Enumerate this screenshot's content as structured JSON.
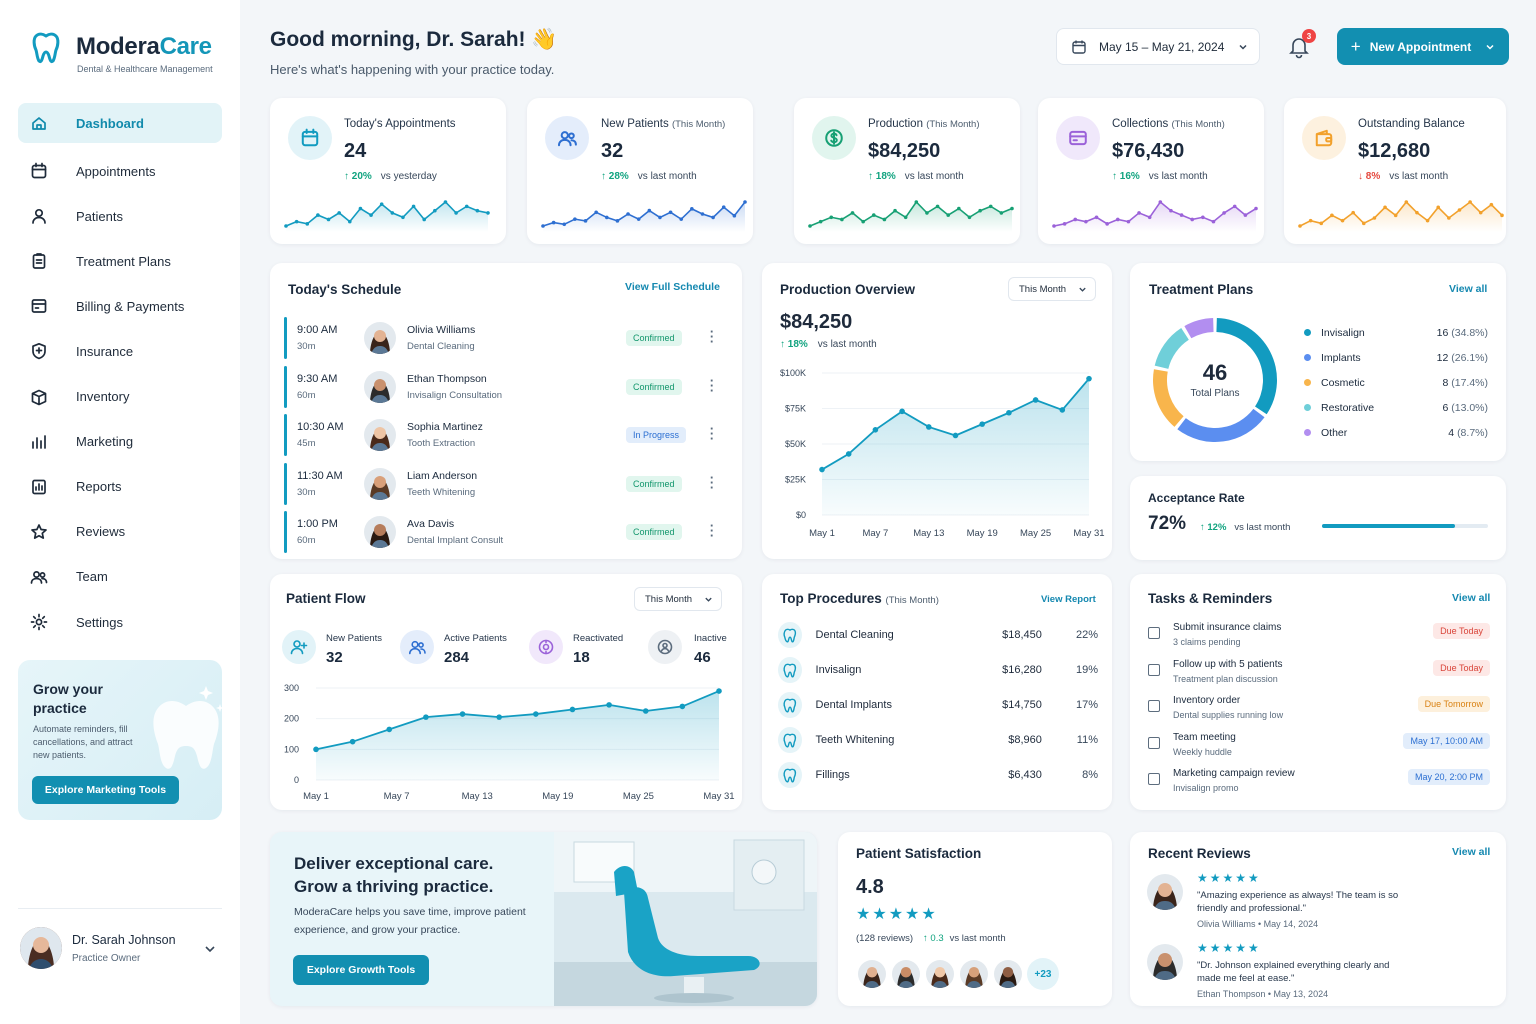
{
  "brand": {
    "name_a": "Modera",
    "name_b": "Care",
    "tagline": "Dental & Healthcare Management"
  },
  "nav": [
    {
      "label": "Dashboard",
      "icon": "home-icon",
      "active": true
    },
    {
      "label": "Appointments",
      "icon": "calendar-icon"
    },
    {
      "label": "Patients",
      "icon": "user-icon"
    },
    {
      "label": "Treatment Plans",
      "icon": "clipboard-icon"
    },
    {
      "label": "Billing & Payments",
      "icon": "credit-card-icon"
    },
    {
      "label": "Insurance",
      "icon": "shield-icon"
    },
    {
      "label": "Inventory",
      "icon": "box-icon"
    },
    {
      "label": "Marketing",
      "icon": "bar-chart-icon"
    },
    {
      "label": "Reports",
      "icon": "report-icon"
    },
    {
      "label": "Reviews",
      "icon": "star-icon"
    },
    {
      "label": "Team",
      "icon": "team-icon"
    },
    {
      "label": "Settings",
      "icon": "gear-icon"
    }
  ],
  "promo": {
    "title": "Grow your practice",
    "text": "Automate reminders, fill cancellations, and attract new patients.",
    "button": "Explore Marketing Tools"
  },
  "user": {
    "name": "Dr. Sarah Johnson",
    "role": "Practice Owner"
  },
  "header": {
    "greeting": "Good morning, Dr. Sarah! 👋",
    "subtitle": "Here's what's happening with your practice today.",
    "date_range": "May 15 – May 21, 2024",
    "notifications": "3",
    "new_button": "New Appointment"
  },
  "kpis": [
    {
      "label": "Today's Appointments",
      "sub": "",
      "value": "24",
      "delta": "20%",
      "dir": "up",
      "vs": "vs yesterday",
      "color": "#129bc0",
      "bg": "#e2f3f8",
      "icon": "calendar-icon",
      "spark": [
        12,
        14,
        13,
        17,
        15,
        18,
        14,
        20,
        17,
        22,
        18,
        16,
        21,
        15,
        19,
        23,
        18,
        21,
        19,
        18
      ]
    },
    {
      "label": "New Patients",
      "sub": "(This Month)",
      "value": "32",
      "delta": "28%",
      "dir": "up",
      "vs": "vs last month",
      "color": "#2e6fd1",
      "bg": "#e4edfb",
      "icon": "users-icon",
      "spark": [
        10,
        12,
        11,
        14,
        13,
        18,
        15,
        13,
        17,
        14,
        19,
        15,
        18,
        14,
        20,
        17,
        15,
        21,
        16,
        24
      ]
    },
    {
      "label": "Production",
      "sub": "(This Month)",
      "value": "$84,250",
      "delta": "18%",
      "dir": "up",
      "vs": "vs last month",
      "color": "#17a074",
      "bg": "#e1f5ee",
      "icon": "dollar-icon",
      "spark": [
        12,
        14,
        16,
        15,
        18,
        14,
        17,
        15,
        19,
        16,
        23,
        18,
        21,
        17,
        20,
        16,
        19,
        21,
        18,
        20
      ]
    },
    {
      "label": "Collections",
      "sub": "(This Month)",
      "value": "$76,430",
      "delta": "16%",
      "dir": "up",
      "vs": "vs last month",
      "color": "#9b62d9",
      "bg": "#f0e8fb",
      "icon": "wallet-icon",
      "spark": [
        10,
        11,
        13,
        12,
        14,
        11,
        13,
        12,
        16,
        14,
        21,
        17,
        15,
        13,
        14,
        12,
        16,
        19,
        15,
        18
      ]
    },
    {
      "label": "Outstanding Balance",
      "sub": "",
      "value": "$12,680",
      "delta": "8%",
      "dir": "down",
      "vs": "vs last month",
      "color": "#f2a12c",
      "bg": "#fdf1df",
      "icon": "folder-wallet-icon",
      "spark": [
        12,
        14,
        13,
        16,
        14,
        17,
        13,
        15,
        19,
        16,
        21,
        17,
        14,
        19,
        15,
        18,
        21,
        17,
        20,
        16
      ]
    }
  ],
  "schedule": {
    "title": "Today's Schedule",
    "link": "View Full Schedule",
    "rows": [
      {
        "time": "9:00 AM",
        "dur": "30m",
        "name": "Olivia Williams",
        "proc": "Dental Cleaning",
        "status": "Confirmed",
        "kind": "green"
      },
      {
        "time": "9:30 AM",
        "dur": "60m",
        "name": "Ethan Thompson",
        "proc": "Invisalign Consultation",
        "status": "Confirmed",
        "kind": "green"
      },
      {
        "time": "10:30 AM",
        "dur": "45m",
        "name": "Sophia Martinez",
        "proc": "Tooth Extraction",
        "status": "In Progress",
        "kind": "blue"
      },
      {
        "time": "11:30 AM",
        "dur": "30m",
        "name": "Liam Anderson",
        "proc": "Teeth Whitening",
        "status": "Confirmed",
        "kind": "green"
      },
      {
        "time": "1:00 PM",
        "dur": "60m",
        "name": "Ava Davis",
        "proc": "Dental Implant Consult",
        "status": "Confirmed",
        "kind": "green"
      }
    ]
  },
  "production": {
    "title": "Production Overview",
    "period": "This Month",
    "value": "$84,250",
    "delta": "18%",
    "vs": "vs last month"
  },
  "treatment": {
    "title": "Treatment Plans",
    "link": "View all",
    "total": "46",
    "total_label": "Total Plans",
    "items": [
      {
        "label": "Invisalign",
        "count": "16",
        "pct": "(34.8%)",
        "color": "#129bc0",
        "value": 16
      },
      {
        "label": "Implants",
        "count": "12",
        "pct": "(26.1%)",
        "color": "#5b8ef0",
        "value": 12
      },
      {
        "label": "Cosmetic",
        "count": "8",
        "pct": "(17.4%)",
        "color": "#f8b54c",
        "value": 8
      },
      {
        "label": "Restorative",
        "count": "6",
        "pct": "(13.0%)",
        "color": "#6fcfd9",
        "value": 6
      },
      {
        "label": "Other",
        "count": "4",
        "pct": "(8.7%)",
        "color": "#b28ef0",
        "value": 4
      }
    ]
  },
  "acceptance": {
    "title": "Acceptance Rate",
    "value": "72%",
    "delta": "12%",
    "vs": "vs last month",
    "progress": 0.8
  },
  "flow": {
    "title": "Patient Flow",
    "period": "This Month",
    "stats": [
      {
        "label": "New Patients",
        "value": "32",
        "icon": "user-plus-icon",
        "bg": "#e2f3f8",
        "color": "#129bc0"
      },
      {
        "label": "Active Patients",
        "value": "284",
        "icon": "users-icon",
        "bg": "#e4edfb",
        "color": "#2e6fd1"
      },
      {
        "label": "Reactivated",
        "value": "18",
        "icon": "refresh-icon",
        "bg": "#f1e8fb",
        "color": "#9b62d9"
      },
      {
        "label": "Inactive",
        "value": "46",
        "icon": "inactive-icon",
        "bg": "#eef1f4",
        "color": "#5d6d7e"
      }
    ]
  },
  "procedures": {
    "title": "Top Procedures",
    "sub": "(This Month)",
    "link": "View Report",
    "rows": [
      {
        "name": "Dental Cleaning",
        "amount": "$18,450",
        "pct": "22%"
      },
      {
        "name": "Invisalign",
        "amount": "$16,280",
        "pct": "19%"
      },
      {
        "name": "Dental Implants",
        "amount": "$14,750",
        "pct": "17%"
      },
      {
        "name": "Teeth Whitening",
        "amount": "$8,960",
        "pct": "11%"
      },
      {
        "name": "Fillings",
        "amount": "$6,430",
        "pct": "8%"
      }
    ]
  },
  "tasks": {
    "title": "Tasks & Reminders",
    "link": "View all",
    "rows": [
      {
        "title": "Submit insurance claims",
        "sub": "3 claims pending",
        "due": "Due Today",
        "kind": "red"
      },
      {
        "title": "Follow up with 5 patients",
        "sub": "Treatment plan discussion",
        "due": "Due Today",
        "kind": "red"
      },
      {
        "title": "Inventory order",
        "sub": "Dental supplies running low",
        "due": "Due Tomorrow",
        "kind": "orange"
      },
      {
        "title": "Team meeting",
        "sub": "Weekly huddle",
        "due": "May 17, 10:00 AM",
        "kind": "blue"
      },
      {
        "title": "Marketing campaign review",
        "sub": "Invisalign promo",
        "due": "May 20, 2:00 PM",
        "kind": "blue"
      }
    ]
  },
  "banner": {
    "line1": "Deliver exceptional care.",
    "line2": "Grow a thriving practice.",
    "text": "ModeraCare helps you save time, improve patient experience, and grow your practice.",
    "button": "Explore Growth Tools"
  },
  "satisfaction": {
    "title": "Patient Satisfaction",
    "score": "4.8",
    "stars": "★★★★★",
    "reviews": "(128 reviews)",
    "delta": "0.3",
    "vs": "vs last month",
    "more": "+23"
  },
  "reviews": {
    "title": "Recent Reviews",
    "link": "View all",
    "items": [
      {
        "stars": "★★★★★",
        "text": "\"Amazing experience as always! The team is so friendly and professional.\"",
        "author": "Olivia Williams",
        "date": "May 14, 2024"
      },
      {
        "stars": "★★★★★",
        "text": "\"Dr. Johnson explained everything clearly and made me feel at ease.\"",
        "author": "Ethan Thompson",
        "date": "May 13, 2024"
      }
    ]
  },
  "chart_data": [
    {
      "type": "line",
      "title": "Production Overview",
      "x": [
        "May 1",
        "May 4",
        "May 7",
        "May 10",
        "May 13",
        "May 16",
        "May 19",
        "May 22",
        "May 25",
        "May 28",
        "May 31"
      ],
      "x_ticks": [
        "May 1",
        "May 7",
        "May 13",
        "May 19",
        "May 25",
        "May 31"
      ],
      "values": [
        32000,
        43000,
        60000,
        73000,
        62000,
        56000,
        64000,
        72000,
        81000,
        74000,
        96000
      ],
      "y_ticks": [
        "$0",
        "$25K",
        "$50K",
        "$75K",
        "$100K"
      ],
      "ylim": [
        0,
        100000
      ]
    },
    {
      "type": "line",
      "title": "Patient Flow",
      "x": [
        "May 1",
        "May 4",
        "May 7",
        "May 10",
        "May 13",
        "May 16",
        "May 19",
        "May 22",
        "May 25",
        "May 28",
        "May 31"
      ],
      "x_ticks": [
        "May 1",
        "May 7",
        "May 13",
        "May 19",
        "May 25",
        "May 31"
      ],
      "values": [
        100,
        125,
        165,
        205,
        215,
        205,
        215,
        230,
        245,
        225,
        240,
        290
      ],
      "y_ticks": [
        "0",
        "100",
        "200",
        "300"
      ],
      "ylim": [
        0,
        300
      ]
    }
  ]
}
